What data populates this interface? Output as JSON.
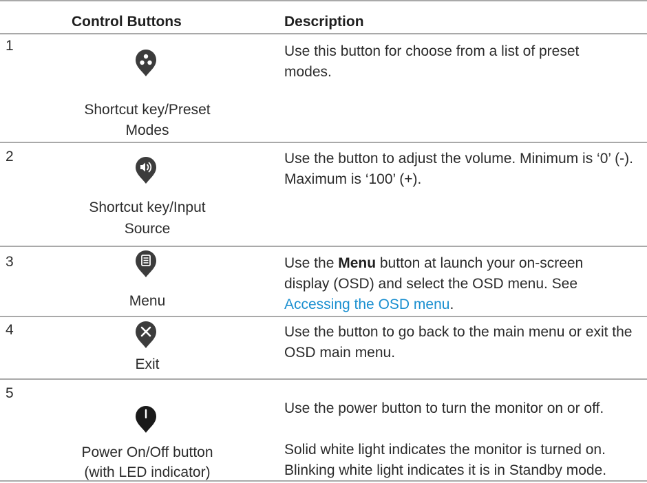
{
  "header": {
    "col_buttons": "Control Buttons",
    "col_description": "Description"
  },
  "rows": [
    {
      "number": "1",
      "icon": "preset-modes-icon",
      "caption_line1": "Shortcut key/Preset",
      "caption_line2": "Modes",
      "description": "Use this button for choose from a list of preset modes."
    },
    {
      "number": "2",
      "icon": "volume-icon",
      "caption_line1": "Shortcut key/Input",
      "caption_line2": "Source",
      "description": "Use the button to adjust the volume. Minimum is ‘0’ (-). Maximum is ‘100’ (+)."
    },
    {
      "number": "3",
      "icon": "menu-icon",
      "caption_line1": "Menu",
      "description_pre": "Use the ",
      "description_bold": "Menu",
      "description_mid": " button at launch your on-screen display (OSD) and select the OSD menu. See ",
      "description_link": "Accessing the OSD menu",
      "description_post": "."
    },
    {
      "number": "4",
      "icon": "exit-icon",
      "caption_line1": "Exit",
      "description": "Use the button to go back to the main menu or exit the OSD main menu."
    },
    {
      "number": "5",
      "icon": "power-icon",
      "caption_line1": "Power On/Off button",
      "caption_line2": "(with LED indicator)",
      "description": "Use the power button to turn the monitor on or off.",
      "description_2": "Solid white light indicates the monitor is turned on. Blinking white light indicates it is in Standby mode."
    }
  ],
  "colors": {
    "icon_fill": "#3c3c3c",
    "link": "#1a8fd0",
    "rule": "#a9a9a9"
  }
}
